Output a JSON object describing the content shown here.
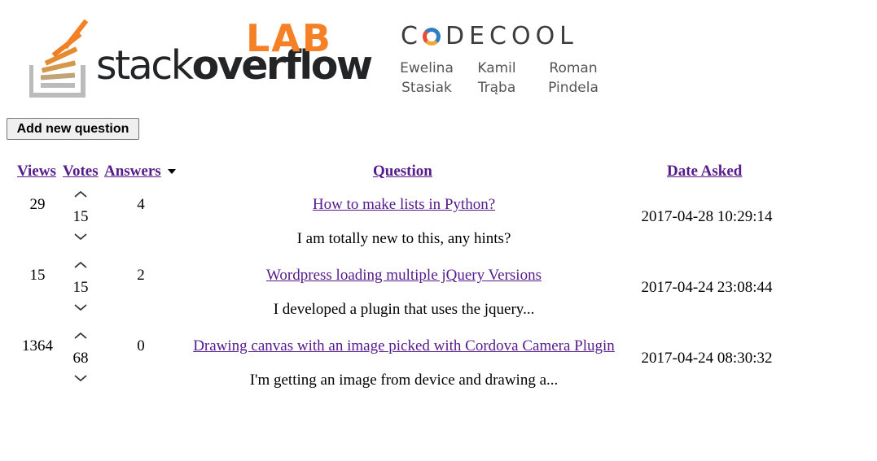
{
  "header": {
    "logo_main": "stackoverflow",
    "logo_main_light": "stack",
    "logo_main_bold": "overflow",
    "lab": "LAB",
    "brand": "CODECOOL",
    "brand_c": "C",
    "brand_rest": "DECOOL",
    "authors": [
      {
        "first": "Ewelina",
        "last": "Stasiak"
      },
      {
        "first": "Kamil",
        "last": "Trąba"
      },
      {
        "first": "Roman",
        "last": "Pindela"
      }
    ],
    "colors": {
      "stack_orange": "#f48024",
      "stack_gray": "#bcbbbb",
      "lab_orange": "#f58025"
    }
  },
  "toolbar": {
    "add_question_label": "Add new question"
  },
  "table": {
    "columns": {
      "views": "Views",
      "votes": "Votes",
      "answers": "Answers",
      "question": "Question",
      "date": "Date Asked"
    },
    "sort": {
      "column": "answers",
      "direction": "descending",
      "icon": "caret-down-icon"
    },
    "rows": [
      {
        "views": "29",
        "votes": "15",
        "answers": "4",
        "title": "How to make lists in Python?",
        "description": "I am totally new to this, any hints?",
        "date": "2017-04-28 10:29:14"
      },
      {
        "views": "15",
        "votes": "15",
        "answers": "2",
        "title": "Wordpress loading multiple jQuery Versions",
        "description": "I developed a plugin that uses the jquery...",
        "date": "2017-04-24 23:08:44"
      },
      {
        "views": "1364",
        "votes": "68",
        "answers": "0",
        "title": "Drawing canvas with an image picked with Cordova Camera Plugin",
        "description": "I'm getting an image from device and drawing a...",
        "date": "2017-04-24 08:30:32"
      }
    ]
  }
}
